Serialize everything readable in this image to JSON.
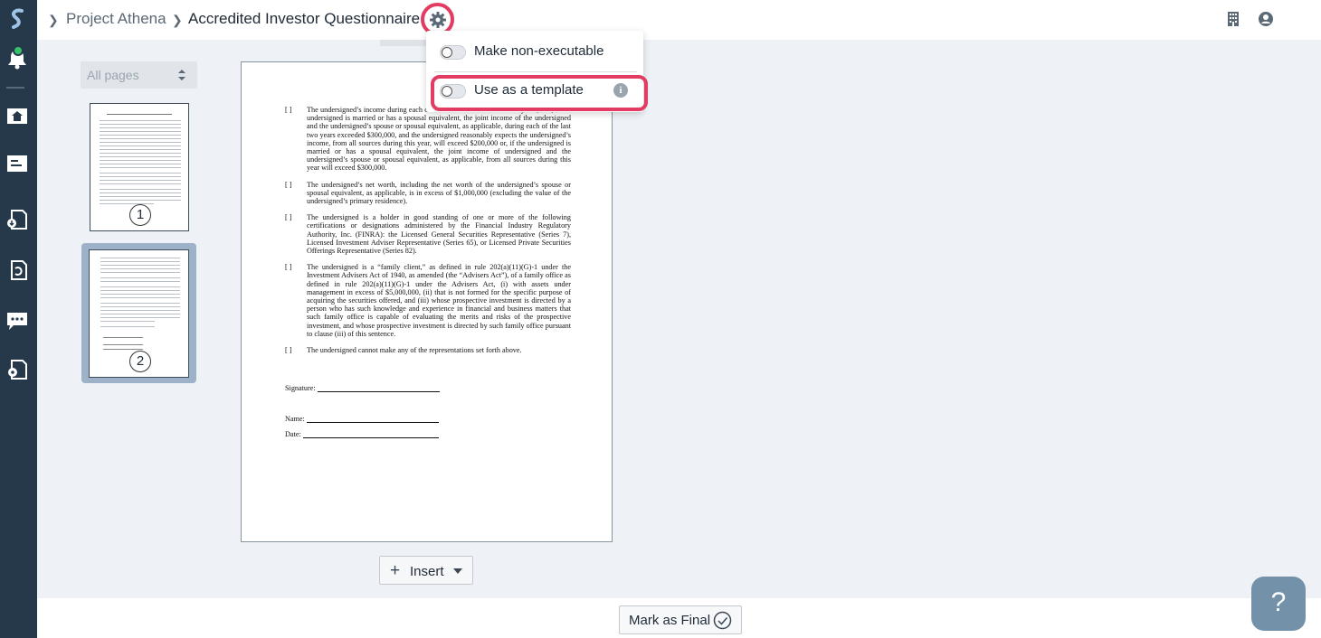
{
  "breadcrumb": {
    "project": "Project Athena",
    "document": "Accredited Investor Questionnaire"
  },
  "pages_select": {
    "value": "All pages"
  },
  "thumbnails": [
    {
      "number": "1"
    },
    {
      "number": "2"
    }
  ],
  "menu": {
    "items": [
      {
        "label": "Make non-executable",
        "enabled": false
      },
      {
        "label": "Use as a template",
        "enabled": false
      }
    ],
    "info_glyph": "i"
  },
  "document": {
    "items": [
      {
        "box": "[ ]",
        "text": "The undersigned’s income during each of the two most recent calendar years, and, if the undersigned is married or has a spousal equivalent, the joint income of the undersigned and the undersigned’s spouse or spousal equivalent, as applicable, during each of the last two years exceeded $300,000, and the undersigned reasonably expects the undersigned’s income, from all sources during this year, will exceed $200,000 or, if the undersigned is married or has a spousal equivalent, the joint income of undersigned and the undersigned’s spouse or spousal equivalent, as applicable, from all sources during this year will exceed $300,000."
      },
      {
        "box": "[ ]",
        "text": "The undersigned’s net worth, including the net worth of the undersigned’s spouse or spousal equivalent, as applicable, is in excess of $1,000,000 (excluding the value of the undersigned’s primary residence)."
      },
      {
        "box": "[ ]",
        "text": "The undersigned is a holder in good standing of one or more of the following certifications or designations administered by the Financial Industry Regulatory Authority, Inc. (FINRA): the Licensed General Securities Representative (Series 7), Licensed Investment Adviser Representative (Series 65), or Licensed Private Securities Offerings Representative (Series 82)."
      },
      {
        "box": "[ ]",
        "text": "The undersigned is a “family client,” as defined in rule 202(a)(11)(G)-1 under the Investment Advisers Act of 1940, as amended (the “Advisers Act”), of a family office as defined in rule 202(a)(11)(G)-1 under the Advisers Act, (i) with assets under management in excess of $5,000,000, (ii) that is not formed for the specific purpose of acquiring the securities offered, and (iii) whose prospective investment is directed by a person who has such knowledge and experience in financial and business matters that such family office is capable of evaluating the merits and risks of the prospective investment, and whose prospective investment is directed by such family office pursuant to clause (iii) of this sentence."
      },
      {
        "box": "[ ]",
        "text": "The undersigned cannot make any of the representations set forth above."
      }
    ],
    "signature_label": "Signature:",
    "name_label": "Name:",
    "date_label": "Date:"
  },
  "insert_button": {
    "label": "Insert"
  },
  "final_button": {
    "label": "Mark as Final"
  },
  "help_button": {
    "label": "?"
  },
  "colors": {
    "nav": "#26394a",
    "highlight": "#e23c62",
    "help": "#7392aa"
  }
}
